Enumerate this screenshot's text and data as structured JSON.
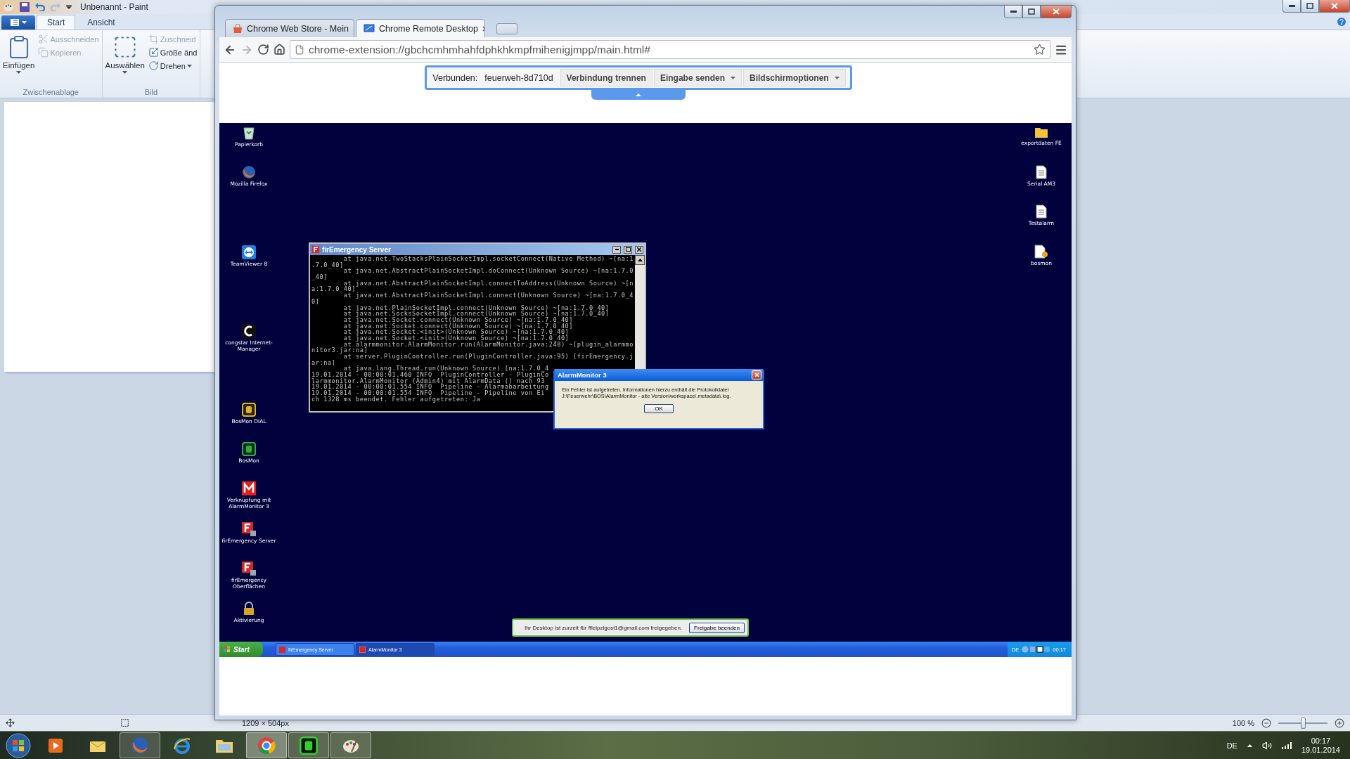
{
  "paint": {
    "title": "Unbenannt - Paint",
    "tabs": [
      {
        "label": "Start",
        "selected": true
      },
      {
        "label": "Ansicht",
        "selected": false
      }
    ],
    "groups": [
      {
        "label": "Zwischenablage",
        "items": [
          {
            "label": "Einfügen",
            "kind": "large",
            "disabled": false,
            "dropdown": true
          },
          {
            "label": "Ausschneiden",
            "kind": "small",
            "disabled": true,
            "dropdown": false
          },
          {
            "label": "Kopieren",
            "kind": "small",
            "disabled": true,
            "dropdown": false
          }
        ]
      },
      {
        "label": "Bild",
        "items": [
          {
            "label": "Auswählen",
            "kind": "large",
            "disabled": false,
            "dropdown": true
          },
          {
            "label": "Zuschneid",
            "kind": "small",
            "disabled": true,
            "dropdown": false
          },
          {
            "label": "Größe änd",
            "kind": "small",
            "disabled": false,
            "dropdown": false
          },
          {
            "label": "Drehen",
            "kind": "small",
            "disabled": false,
            "dropdown": true
          }
        ]
      }
    ],
    "status": {
      "size": "1209 × 504px",
      "zoom": "100 %",
      "zoom_slider": {
        "level": 0.5
      }
    }
  },
  "chrome": {
    "tabs": [
      {
        "title": "Chrome Web Store - Mein",
        "selected": false
      },
      {
        "title": "Chrome Remote Desktop",
        "selected": true
      }
    ],
    "url": "chrome-extension://gbchcmhmhahfdphkhkmpfmihenigjmpp/main.html#",
    "forward_disabled": true,
    "remote_toolbar": {
      "label": "Verbunden:",
      "host": "feuerweh-8d710d",
      "buttons": [
        {
          "label": "Verbindung trennen",
          "dropdown": false
        },
        {
          "label": "Eingabe senden",
          "dropdown": true
        },
        {
          "label": "Bildschirmoptionen",
          "dropdown": true
        }
      ]
    }
  },
  "remote_desktop": {
    "icons_left": [
      "Papierkorb",
      "Mozilla Firefox",
      "TeamViewer 8",
      "congstar Internet-Manager",
      "BosMon DIAL",
      "BosMon",
      "Verknüpfung mit AlarmMonitor 3",
      "firEmergency Server",
      "firEmergency Oberflächen",
      "Aktivierung"
    ],
    "icons_right": [
      "exportdaten FE",
      "Serial AM3",
      "Testalarm",
      "bosmon"
    ],
    "console": {
      "title": "firEmergency Server",
      "lines": [
        "        at java.net.TwoStacksPlainSocketImpl.socketConnect(Native Method) ~[na:1",
        ".7.0_40]",
        "        at java.net.AbstractPlainSocketImpl.doConnect(Unknown Source) ~[na:1.7.0",
        "_40]",
        "        at java.net.AbstractPlainSocketImpl.connectToAddress(Unknown Source) ~[n",
        "a:1.7.0_40]",
        "        at java.net.AbstractPlainSocketImpl.connect(Unknown Source) ~[na:1.7.0_4",
        "0]",
        "        at java.net.PlainSocketImpl.connect(Unknown Source) ~[na:1.7.0_40]",
        "        at java.net.SocksSocketImpl.connect(Unknown Source) ~[na:1.7.0_40]",
        "        at java.net.Socket.connect(Unknown Source) ~[na:1.7.0_40]",
        "        at java.net.Socket.connect(Unknown Source) ~[na:1.7.0_40]",
        "        at java.net.Socket.<init>(Unknown Source) ~[na:1.7.0_40]",
        "        at java.net.Socket.<init>(Unknown Source) ~[na:1.7.0_40]",
        "        at alarmmonitor.AlarmMonitor.run(AlarmMonitor.java:248) ~[plugin_alarmmo",
        "nitor3.jar:na]",
        "        at server.PluginController.run(PluginController.java:95) [firEmergency.j",
        "ar:na]",
        "        at java.lang.Thread.run(Unknown Source) [na:1.7.0_4",
        "19.01.2014 - 00:00:01.460 INFO  PluginController - PluginCo",
        "larmmonitor.AlarmMonitor (Admin4) mit AlarmData () nach 93",
        "19.01.2014 - 00:00:01.554 INFO  Pipeline - Alarmabarbeitung",
        "19.01.2014 - 00:00:01.554 INFO  Pipeline - Pipeline von Ei",
        "ch 1328 ms beendet. Fehler aufgetreten: Ja"
      ]
    },
    "dialog": {
      "title": "AlarmMonitor 3",
      "message": [
        "Ein Fehler ist aufgetreten. Informationen hierzu enthält die Protokolldatei",
        "J:\\Feuerwehr\\BOS\\AlarmMonitor - alte Version\\workspace\\.metadata\\.log."
      ],
      "button": "OK"
    },
    "share_bar": {
      "text": "Ihr Desktop ist zurzeit für ffleipzigost1@gmail.com freigegeben.",
      "button": "Freigabe beenden"
    },
    "taskbar": {
      "start": "Start",
      "tasks": [
        {
          "label": "firEmergency Server",
          "selected": false
        },
        {
          "label": "AlarmMonitor 3",
          "selected": true
        }
      ],
      "language": "DE",
      "clock": "00:17"
    }
  },
  "taskbar": {
    "apps": [
      {
        "running": false,
        "selected": false
      },
      {
        "running": false,
        "selected": false
      },
      {
        "running": true,
        "selected": false
      },
      {
        "running": false,
        "selected": false
      },
      {
        "running": false,
        "selected": false
      },
      {
        "running": true,
        "selected": true
      },
      {
        "running": true,
        "selected": false
      },
      {
        "running": true,
        "selected": false
      }
    ],
    "language": "DE",
    "time": "00:17",
    "date": "19.01.2014"
  }
}
